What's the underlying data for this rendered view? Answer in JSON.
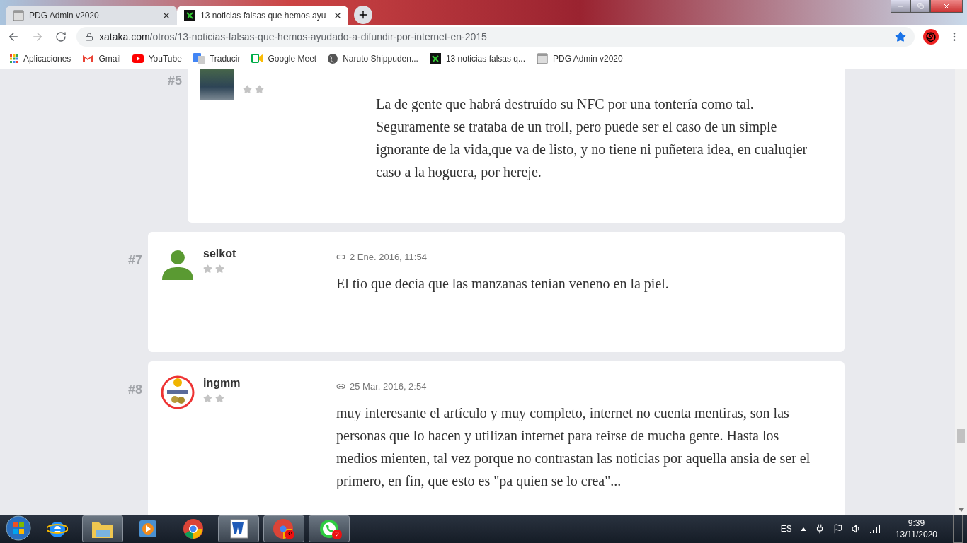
{
  "browser": {
    "tabs": [
      {
        "title": "PDG Admin v2020",
        "kind": "page",
        "selected": false
      },
      {
        "title": "13 noticias falsas que hemos ayu",
        "kind": "site",
        "selected": true
      }
    ],
    "url_host": "xataka.com",
    "url_path": "/otros/13-noticias-falsas-que-hemos-ayudado-a-difundir-por-internet-en-2015",
    "bookmarks": [
      {
        "label": "Aplicaciones",
        "kind": "apps"
      },
      {
        "label": "Gmail",
        "kind": "gmail"
      },
      {
        "label": "YouTube",
        "kind": "youtube"
      },
      {
        "label": "Traducir",
        "kind": "translate"
      },
      {
        "label": "Google Meet",
        "kind": "meet"
      },
      {
        "label": "Naruto Shippuden...",
        "kind": "globe"
      },
      {
        "label": "13 noticias falsas q...",
        "kind": "site"
      },
      {
        "label": "PDG Admin v2020",
        "kind": "page"
      }
    ]
  },
  "comments": [
    {
      "number": "#5",
      "kind": "reply",
      "avatar": {
        "kind": "photo"
      },
      "text": "La de gente que habrá destruído su NFC por una tontería como tal. Seguramente se trataba de un troll, pero puede ser el caso de un simple ignorante de la vida,que va de listo, y no tiene ni puñetera idea, en cualuqier caso a la hoguera, por hereje."
    },
    {
      "number": "#7",
      "kind": "comment",
      "avatar": {
        "kind": "silhouette"
      },
      "author": "selkot",
      "date": "2 Ene. 2016, 11:54",
      "text": "El tío que decía que las manzanas tenían veneno en la piel."
    },
    {
      "number": "#8",
      "kind": "comment",
      "avatar": {
        "kind": "logo"
      },
      "author": "ingmm",
      "date": "25 Mar. 2016, 2:54",
      "text": "muy interesante el artículo y muy completo, internet no cuenta mentiras, son las personas que lo hacen y utilizan internet para reirse de mucha gente. Hasta los medios mienten, tal vez porque no contrastan las noticias por aquella ansia de ser el primero, en fin, que esto es \"pa quien se lo crea\"..."
    }
  ],
  "taskbar": {
    "apps": [
      {
        "kind": "ie",
        "running": false
      },
      {
        "kind": "explorer",
        "running": true
      },
      {
        "kind": "media",
        "running": false
      },
      {
        "kind": "chrome",
        "running": false
      },
      {
        "kind": "word",
        "running": true
      },
      {
        "kind": "chrome-profile",
        "running": true
      },
      {
        "kind": "whatsapp",
        "running": true,
        "badge": "2"
      }
    ],
    "language": "ES",
    "time": "9:39",
    "date": "13/11/2020"
  }
}
